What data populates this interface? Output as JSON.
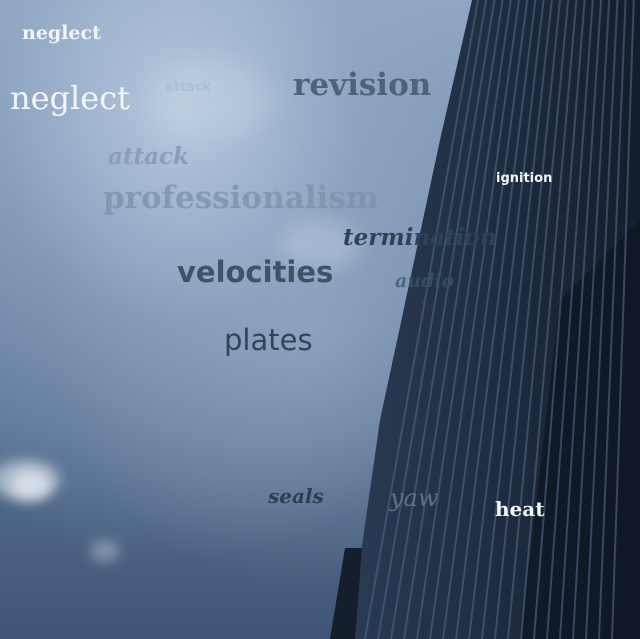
{
  "words": {
    "w1": "neglect",
    "w2": "neglect",
    "w3": "attack",
    "w4": "revision",
    "w5": "attack",
    "w6": "professionalism",
    "w7": "ignition",
    "w8": "termination",
    "w9": "velocities",
    "w10": "audio",
    "w11": "plates",
    "w12": "seals",
    "w13": "yaw",
    "w14": "heat"
  },
  "colors": {
    "sky_light": "#8ea6c2",
    "sky_dark": "#3f5574",
    "building_dark": "#1b2637",
    "building_stripe": "#34455e",
    "word_white": "#f2f5f9",
    "word_slate": "#3d566c",
    "word_pale": "#9db0c6"
  }
}
